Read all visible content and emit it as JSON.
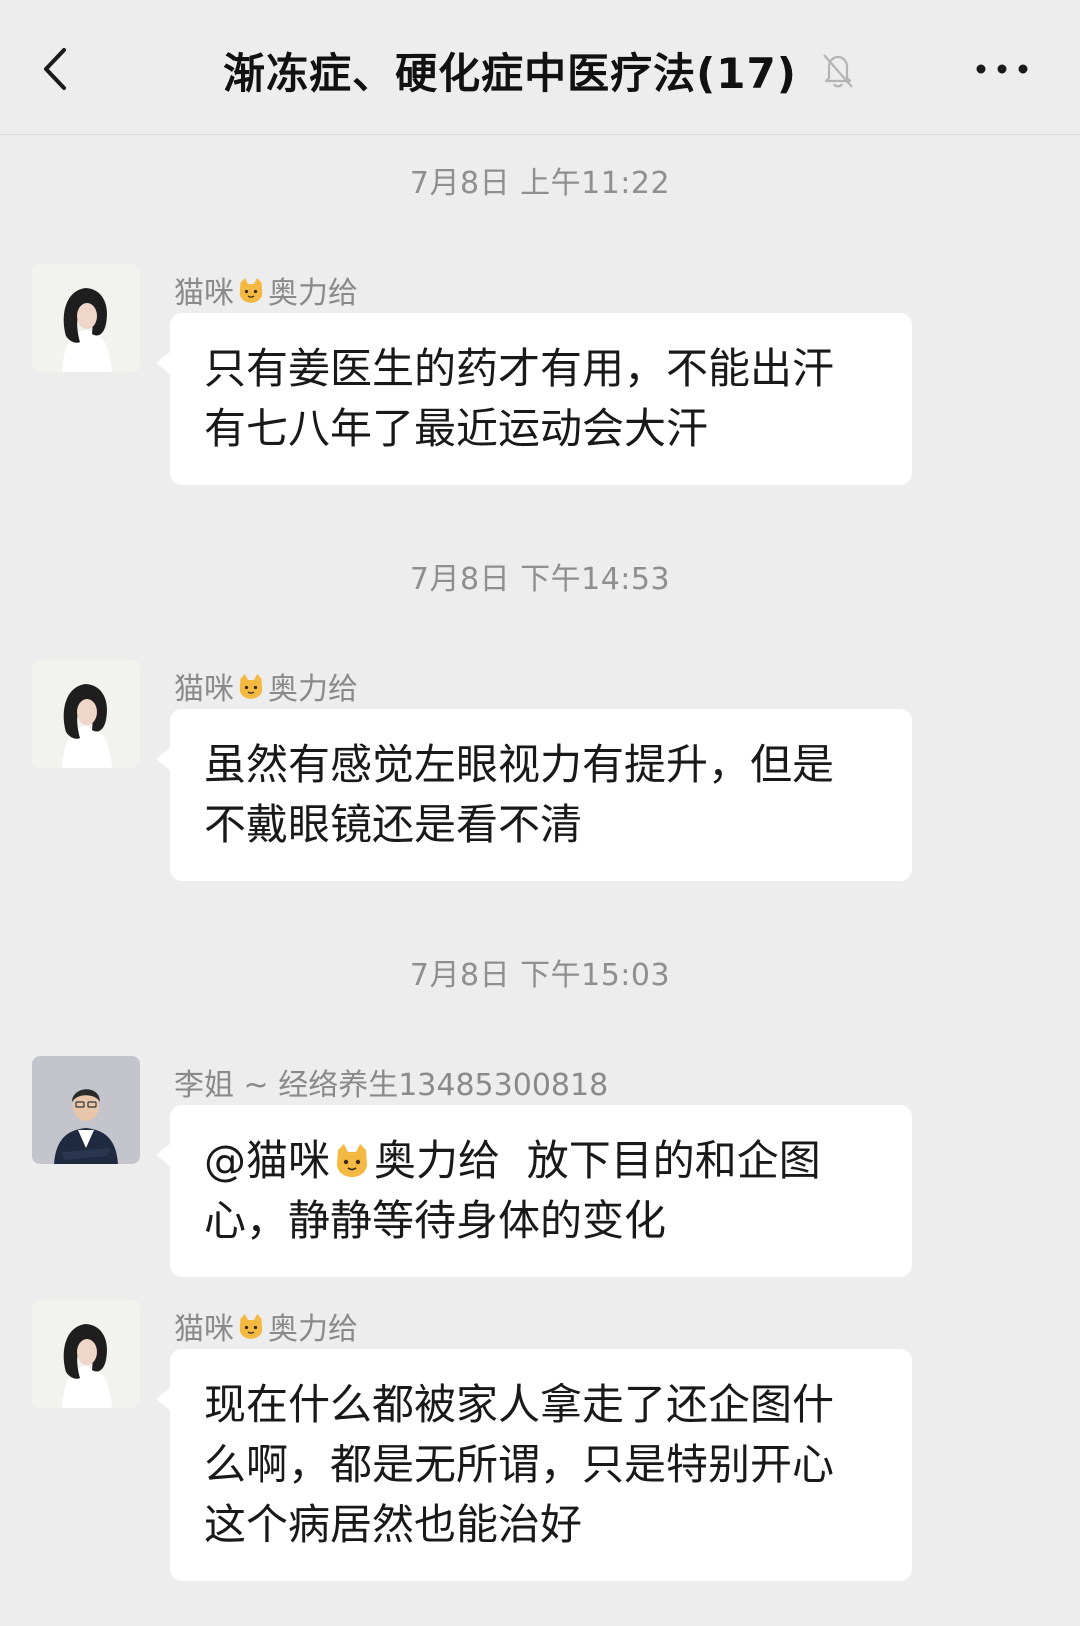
{
  "header": {
    "title": "渐冻症、硬化症中医疗法(17)",
    "back_icon": "chevron-left-icon",
    "mute_icon": "bell-muted-icon",
    "more_icon": "more-horizontal-icon"
  },
  "messages": [
    {
      "timestamp": "7月8日 上午11:22",
      "sender_before": "猫咪",
      "sender_emoji": "cat-face-icon",
      "sender_after": "奥力给",
      "avatar": "woman-portrait-avatar",
      "lines": [
        "只有姜医生的药才有用，不能出汗",
        "有七八年了最近运动会大汗"
      ]
    },
    {
      "timestamp": "7月8日 下午14:53",
      "sender_before": "猫咪",
      "sender_emoji": "cat-face-icon",
      "sender_after": "奥力给",
      "avatar": "woman-portrait-avatar",
      "lines": [
        "虽然有感觉左眼视力有提升，但是",
        "不戴眼镜还是看不清"
      ]
    },
    {
      "timestamp": "7月8日 下午15:03",
      "sender": "李姐 ~ 经络养生13485300818",
      "avatar": "man-suit-avatar",
      "mention_before": "@猫咪",
      "mention_emoji": "cat-face-icon",
      "mention_after": "奥力给  放下目的和企图",
      "lines": [
        "心，静静等待身体的变化"
      ]
    },
    {
      "sender_before": "猫咪",
      "sender_emoji": "cat-face-icon",
      "sender_after": "奥力给",
      "avatar": "woman-portrait-avatar",
      "lines": [
        "现在什么都被家人拿走了还企图什",
        "么啊，都是无所谓，只是特别开心",
        "这个病居然也能治好"
      ]
    }
  ],
  "colors": {
    "background": "#ededed",
    "bubble": "#ffffff",
    "timestamp_text": "#8f8f8f",
    "sender_text": "#8a8a8a"
  }
}
